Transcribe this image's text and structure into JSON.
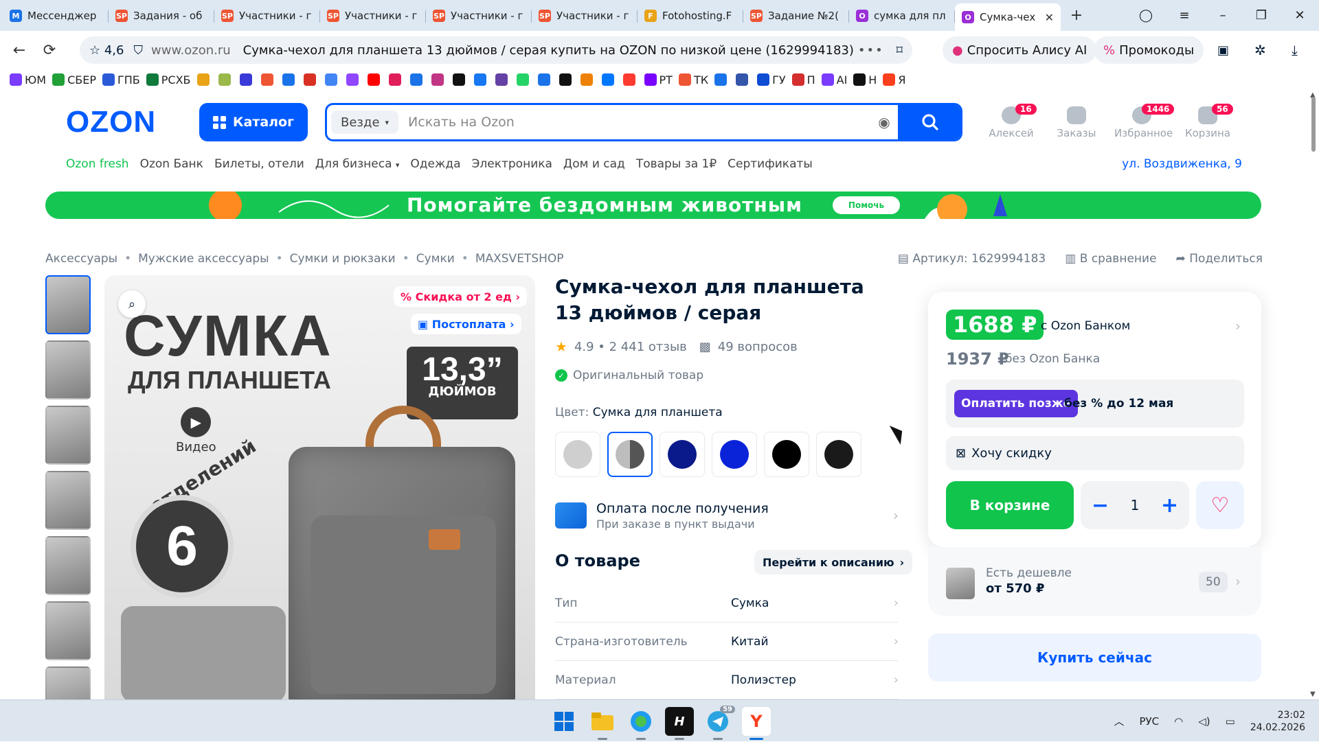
{
  "browser": {
    "tabs": [
      {
        "label": "Мессенджер",
        "fav": "M",
        "color": "#1a73e8"
      },
      {
        "label": "Задания - об",
        "fav": "SP",
        "color": "#e53"
      },
      {
        "label": "Участники - г",
        "fav": "SP",
        "color": "#e53"
      },
      {
        "label": "Участники - г",
        "fav": "SP",
        "color": "#e53"
      },
      {
        "label": "Участники - г",
        "fav": "SP",
        "color": "#e53"
      },
      {
        "label": "Участники - г",
        "fav": "SP",
        "color": "#e53"
      },
      {
        "label": "Fotohosting.F",
        "fav": "F",
        "color": "#e8a317"
      },
      {
        "label": "Задание №2(",
        "fav": "SP",
        "color": "#e53"
      },
      {
        "label": "сумка для пл",
        "fav": "O",
        "color": "#9b2fd6"
      },
      {
        "label": "Сумка-чех",
        "fav": "O",
        "color": "#9b2fd6",
        "active": true
      }
    ],
    "rating": "4,6",
    "domain": "www.ozon.ru",
    "page_title": "Сумка-чехол для планшета 13 дюймов / серая купить на OZON по низкой цене (1629994183)",
    "alice": "Спросить Алису AI",
    "promo": "Промокоды",
    "bookmarks": [
      {
        "label": "ЮМ",
        "color": "#7a3cff"
      },
      {
        "label": "СБЕР",
        "color": "#21a038"
      },
      {
        "label": "ГПБ",
        "color": "#2a5ad8"
      },
      {
        "label": "РСХБ",
        "color": "#0f7a3c"
      },
      {
        "label": "",
        "color": "#e8a317"
      },
      {
        "label": "",
        "color": "#9bb84a"
      },
      {
        "label": "",
        "color": "#3a3ad8"
      },
      {
        "label": "",
        "color": "#e53"
      },
      {
        "label": "",
        "color": "#1a73e8"
      },
      {
        "label": "",
        "color": "#d93025"
      },
      {
        "label": "",
        "color": "#4285f4"
      },
      {
        "label": "",
        "color": "#9146ff"
      },
      {
        "label": "",
        "color": "#ff0000"
      },
      {
        "label": "",
        "color": "#e01e5a"
      },
      {
        "label": "",
        "color": "#1a73e8"
      },
      {
        "label": "",
        "color": "#c13584"
      },
      {
        "label": "",
        "color": "#111111"
      },
      {
        "label": "",
        "color": "#1877f2"
      },
      {
        "label": "",
        "color": "#6441a5"
      },
      {
        "label": "",
        "color": "#25d366"
      },
      {
        "label": "",
        "color": "#1a73e8"
      },
      {
        "label": "",
        "color": "#111111"
      },
      {
        "label": "",
        "color": "#ee8208"
      },
      {
        "label": "",
        "color": "#0077ff"
      },
      {
        "label": "",
        "color": "#ff3b30"
      },
      {
        "label": "РТ",
        "color": "#7a00ff"
      },
      {
        "label": "ТК",
        "color": "#e53"
      },
      {
        "label": "",
        "color": "#1a73e8"
      },
      {
        "label": "",
        "color": "#3355aa"
      },
      {
        "label": "ГУ",
        "color": "#0d4cd3"
      },
      {
        "label": "П",
        "color": "#d32f2f"
      },
      {
        "label": "AI",
        "color": "#7a3cff"
      },
      {
        "label": "Н",
        "color": "#111111"
      },
      {
        "label": "Я",
        "color": "#fc3f1d"
      }
    ]
  },
  "header": {
    "logo": "OZON",
    "catalog": "Каталог",
    "search_scope": "Везде",
    "search_placeholder": "Искать на Ozon",
    "user": {
      "label": "Алексей",
      "badge": "16"
    },
    "orders": {
      "label": "Заказы"
    },
    "favorites": {
      "label": "Избранное",
      "badge": "1446"
    },
    "cart": {
      "label": "Корзина",
      "badge": "56"
    },
    "subnav": [
      "Ozon fresh",
      "Ozon Банк",
      "Билеты, отели",
      "Для бизнеса",
      "Одежда",
      "Электроника",
      "Дом и сад",
      "Товары за 1₽",
      "Сертификаты"
    ],
    "address": "ул. Воздвиженка, 9"
  },
  "banner": {
    "text": "Помогайте бездомным животным",
    "button": "Помочь"
  },
  "breadcrumb": [
    "Аксессуары",
    "Мужские аксессуары",
    "Сумки и рюкзаки",
    "Сумки",
    "MAXSVETSHOP"
  ],
  "meta": {
    "article": "Артикул: 1629994183",
    "compare": "В сравнение",
    "share": "Поделиться"
  },
  "gallery": {
    "chip_discount": "Скидка от 2 ед",
    "chip_postpay": "Постоплата",
    "title_big": "СУМКА",
    "title_small": "ДЛЯ ПЛАНШЕТА",
    "size_big": "13,3”",
    "size_small": "ДЮЙМОВ",
    "video": "Видео",
    "sections_word": "отделений",
    "sections_num": "6"
  },
  "product": {
    "title": "Сумка-чехол для планшета 13 дюймов / серая",
    "rating": "4.9 • 2 441 отзыв",
    "questions": "49 вопросов",
    "original": "Оригинальный товар",
    "color_label": "Цвет:",
    "color_value": "Сумка для планшета",
    "swatches": [
      {
        "color": "#cfcfcf"
      },
      {
        "color": "half"
      },
      {
        "color": "#0a1a8a"
      },
      {
        "color": "#0a23d8"
      },
      {
        "color": "#000000"
      },
      {
        "color": "#1a1a1a"
      }
    ],
    "pay_after_title": "Оплата после получения",
    "pay_after_sub": "При заказе в пункт выдачи",
    "about": "О товаре",
    "go_desc": "Перейти к описанию",
    "specs": [
      {
        "k": "Тип",
        "v": "Сумка"
      },
      {
        "k": "Страна-изготовитель",
        "v": "Китай"
      },
      {
        "k": "Материал",
        "v": "Полиэстер"
      }
    ]
  },
  "buy": {
    "price_bank": "1688 ₽",
    "price_bank_label": "с Ozon Банком",
    "price_regular": "1937 ₽",
    "price_regular_label": "без Ozon Банка",
    "pay_later": "Оплатить позже",
    "pay_later_text": "без % до 12 мая",
    "want_discount": "Хочу скидку",
    "in_cart": "В корзине",
    "qty": "1",
    "cheaper_label": "Есть дешевле",
    "cheaper_price": "от 570 ₽",
    "cheaper_count": "50",
    "buy_now": "Купить сейчас"
  },
  "taskbar": {
    "lang": "РУС",
    "time": "23:02",
    "date": "24.02.2026",
    "telegram_badge": "59"
  }
}
